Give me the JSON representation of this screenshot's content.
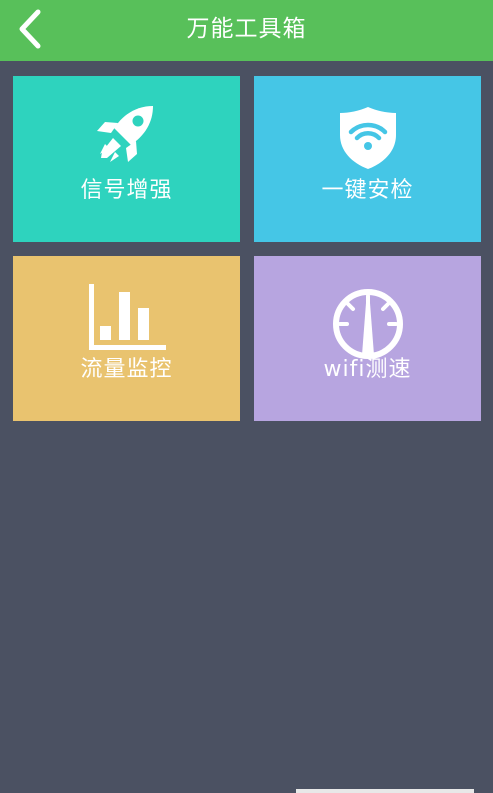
{
  "header": {
    "title": "万能工具箱",
    "back_icon": "chevron-left-icon",
    "background_color": "#58c05a"
  },
  "background_color": "#4b5162",
  "tiles": [
    {
      "label": "信号增强",
      "icon": "rocket-icon",
      "color": "#2ed3be"
    },
    {
      "label": "一键安检",
      "icon": "shield-wifi-icon",
      "color": "#45c6e6"
    },
    {
      "label": "流量监控",
      "icon": "bar-chart-icon",
      "color": "#e9c36f"
    },
    {
      "label": "wifi测速",
      "icon": "speedometer-icon",
      "color": "#b7a5e0"
    }
  ]
}
